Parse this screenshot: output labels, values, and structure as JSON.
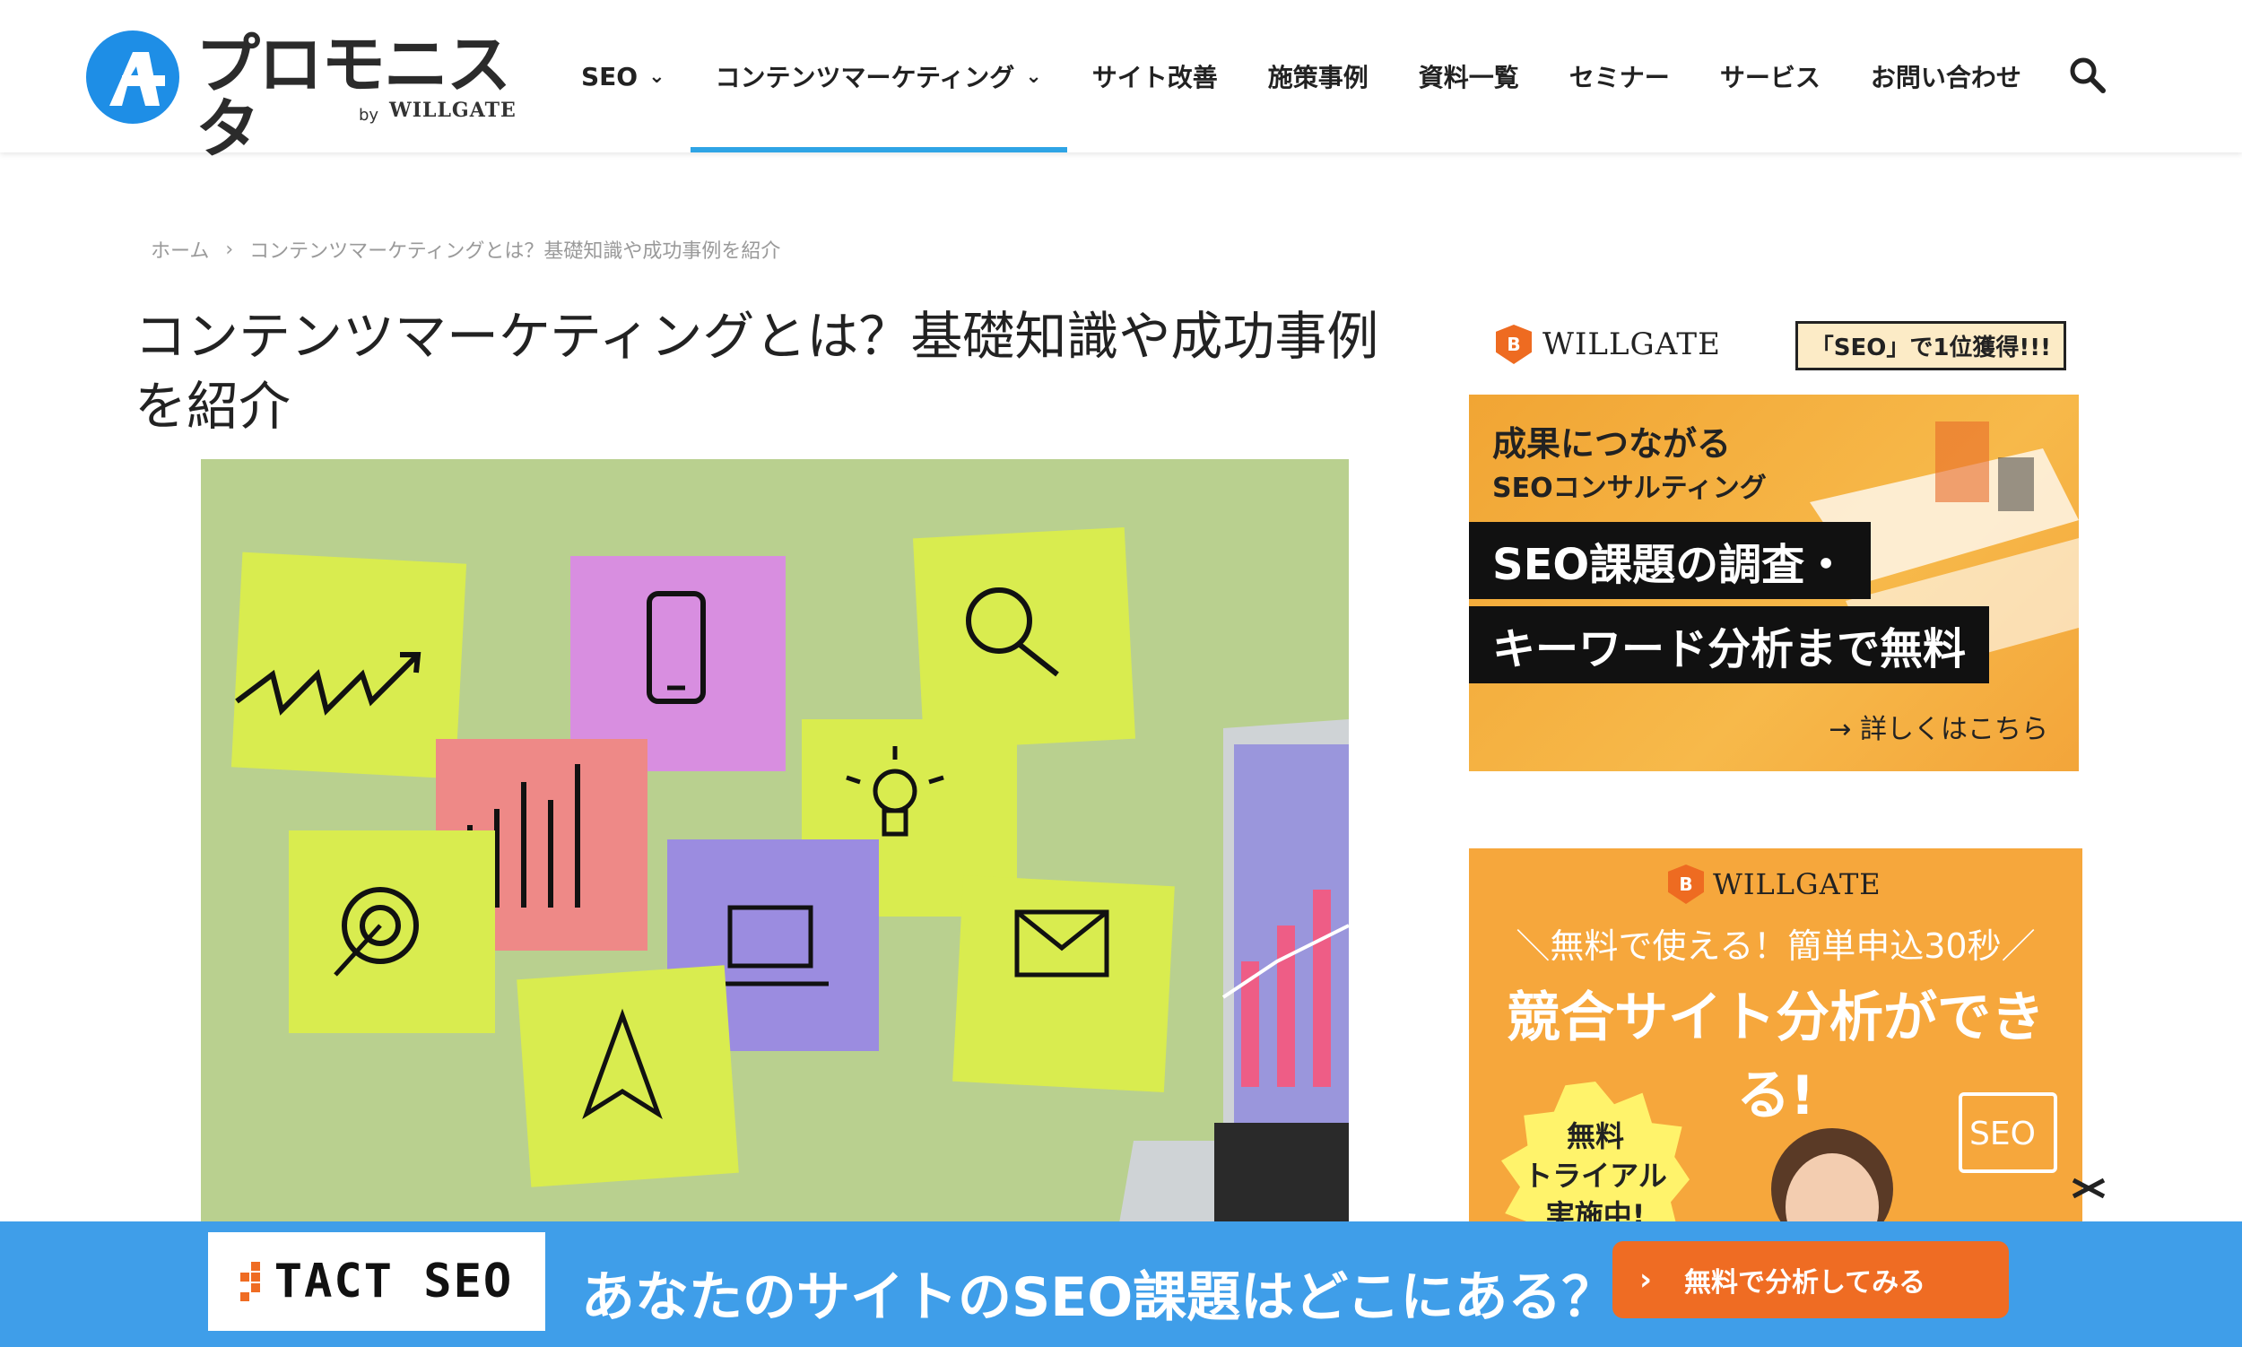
{
  "header": {
    "logo_text": "プロモニスタ",
    "logo_by": "by",
    "logo_brand": "WILLGATE",
    "nav": [
      {
        "label": "SEO",
        "has_dropdown": true
      },
      {
        "label": "コンテンツマーケティング",
        "has_dropdown": true,
        "active": true
      },
      {
        "label": "サイト改善"
      },
      {
        "label": "施策事例"
      },
      {
        "label": "資料一覧"
      },
      {
        "label": "セミナー"
      },
      {
        "label": "サービス"
      },
      {
        "label": "お問い合わせ"
      }
    ],
    "chevron": "⌄",
    "accent_color": "#2ea4e5"
  },
  "breadcrumb": {
    "home": "ホーム",
    "separator": "›",
    "current": "コンテンツマーケティングとは？基礎知識や成功事例を紹介"
  },
  "article": {
    "title": "コンテンツマーケティングとは？基礎知識や成功事例を紹介"
  },
  "ad1": {
    "brand": "WILLGATE",
    "badge": "「SEO」で1位獲得!!!",
    "subtitle1": "成果につながる",
    "subtitle2": "SEOコンサルティング",
    "line1": "SEO課題の調査・",
    "line2": "キーワード分析まで無料",
    "more": "→ 詳しくはこちら"
  },
  "ad2": {
    "brand": "WILLGATE",
    "tagline": "＼無料で使える！簡単申込30秒／",
    "headline": "競合サイト分析ができる!",
    "star1": "無料",
    "star2": "トライアル",
    "star3": "実施中!",
    "seo_box": "SEO"
  },
  "bottom_banner": {
    "logo": "TACT SEO",
    "text": "あなたのサイトのSEO課題はどこにある？",
    "cta": "無料で分析してみる",
    "cta_arrow": "›",
    "bg_color": "#3f9ee9",
    "cta_color": "#ef6c23"
  }
}
